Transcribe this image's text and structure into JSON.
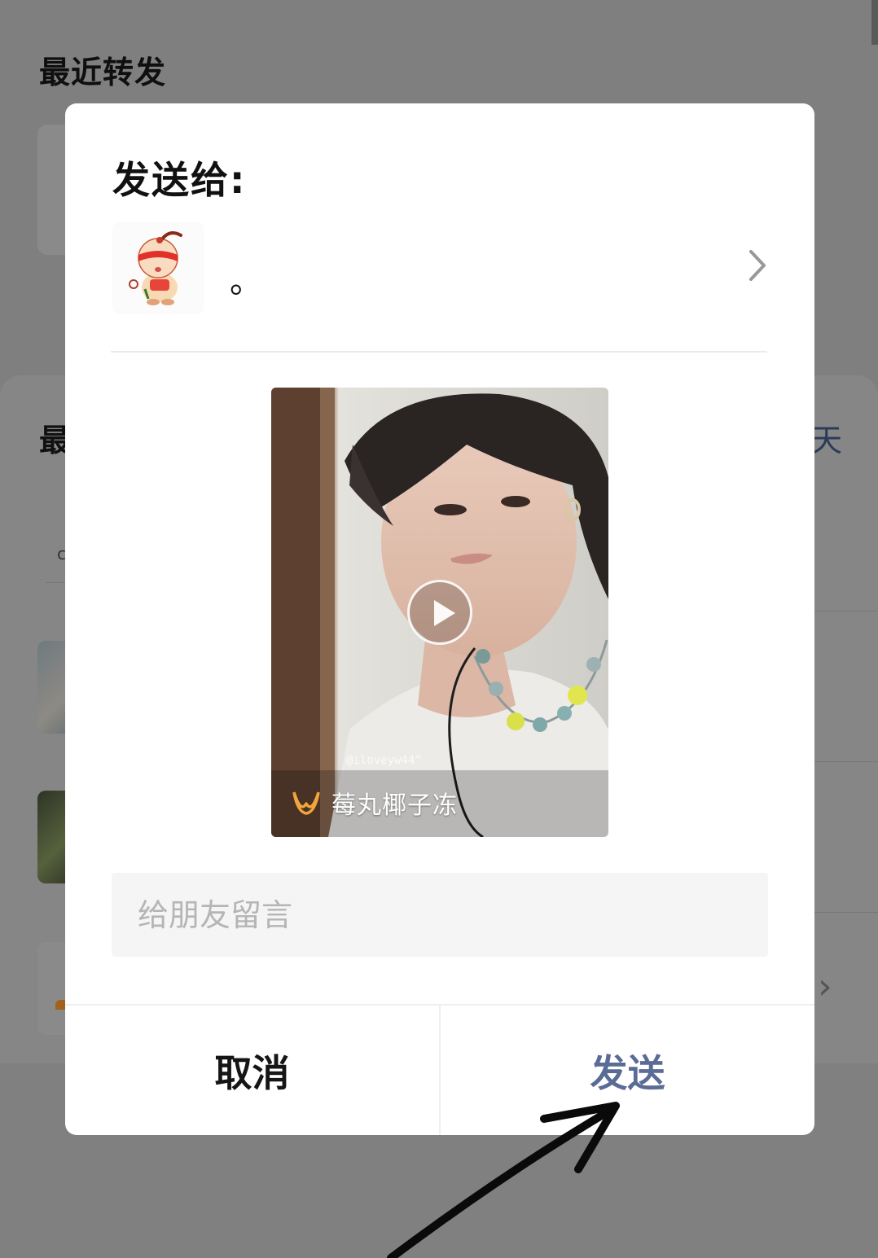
{
  "background": {
    "recent_title": "最近转发",
    "section_title": "最",
    "right_text": "天",
    "small_text": "c"
  },
  "dialog": {
    "title": "发送给:",
    "recipient": {
      "name": "。"
    },
    "preview": {
      "watermark": "@iloveyw44^",
      "brand_name": "莓丸椰子冻"
    },
    "message": {
      "placeholder": "给朋友留言",
      "value": ""
    },
    "buttons": {
      "cancel": "取消",
      "send": "发送"
    }
  },
  "colors": {
    "send_accent": "#5a6c96",
    "overlay": "#7f7f7f",
    "brand_logo": "#f2a53a"
  }
}
